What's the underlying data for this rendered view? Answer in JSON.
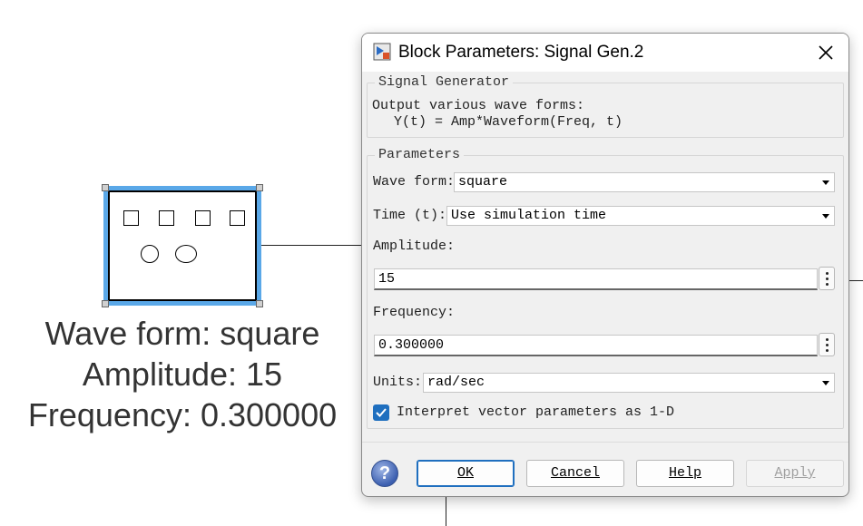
{
  "block": {
    "label_lines": [
      "Wave form: square",
      "Amplitude: 15",
      "Frequency: 0.300000"
    ]
  },
  "dialog": {
    "title": "Block Parameters: Signal Gen.2",
    "description_group": {
      "legend": "Signal Generator",
      "line1": "Output various wave forms:",
      "line2": "Y(t) = Amp*Waveform(Freq, t)"
    },
    "parameters": {
      "legend": "Parameters",
      "wave_form_label": "Wave form:",
      "wave_form_value": "square",
      "time_label": "Time (t):",
      "time_value": "Use simulation time",
      "amplitude_label": "Amplitude:",
      "amplitude_value": "15",
      "frequency_label": "Frequency:",
      "frequency_value": "0.300000",
      "units_label": "Units:",
      "units_value": "rad/sec",
      "interpret_label": "Interpret vector parameters as 1-D",
      "interpret_checked": true
    },
    "buttons": {
      "ok": "OK",
      "cancel": "Cancel",
      "help": "Help",
      "apply": "Apply",
      "help_icon": "?"
    }
  },
  "colors": {
    "selection_blue": "#5aa8e8",
    "checkbox_blue": "#1f6fbf"
  }
}
